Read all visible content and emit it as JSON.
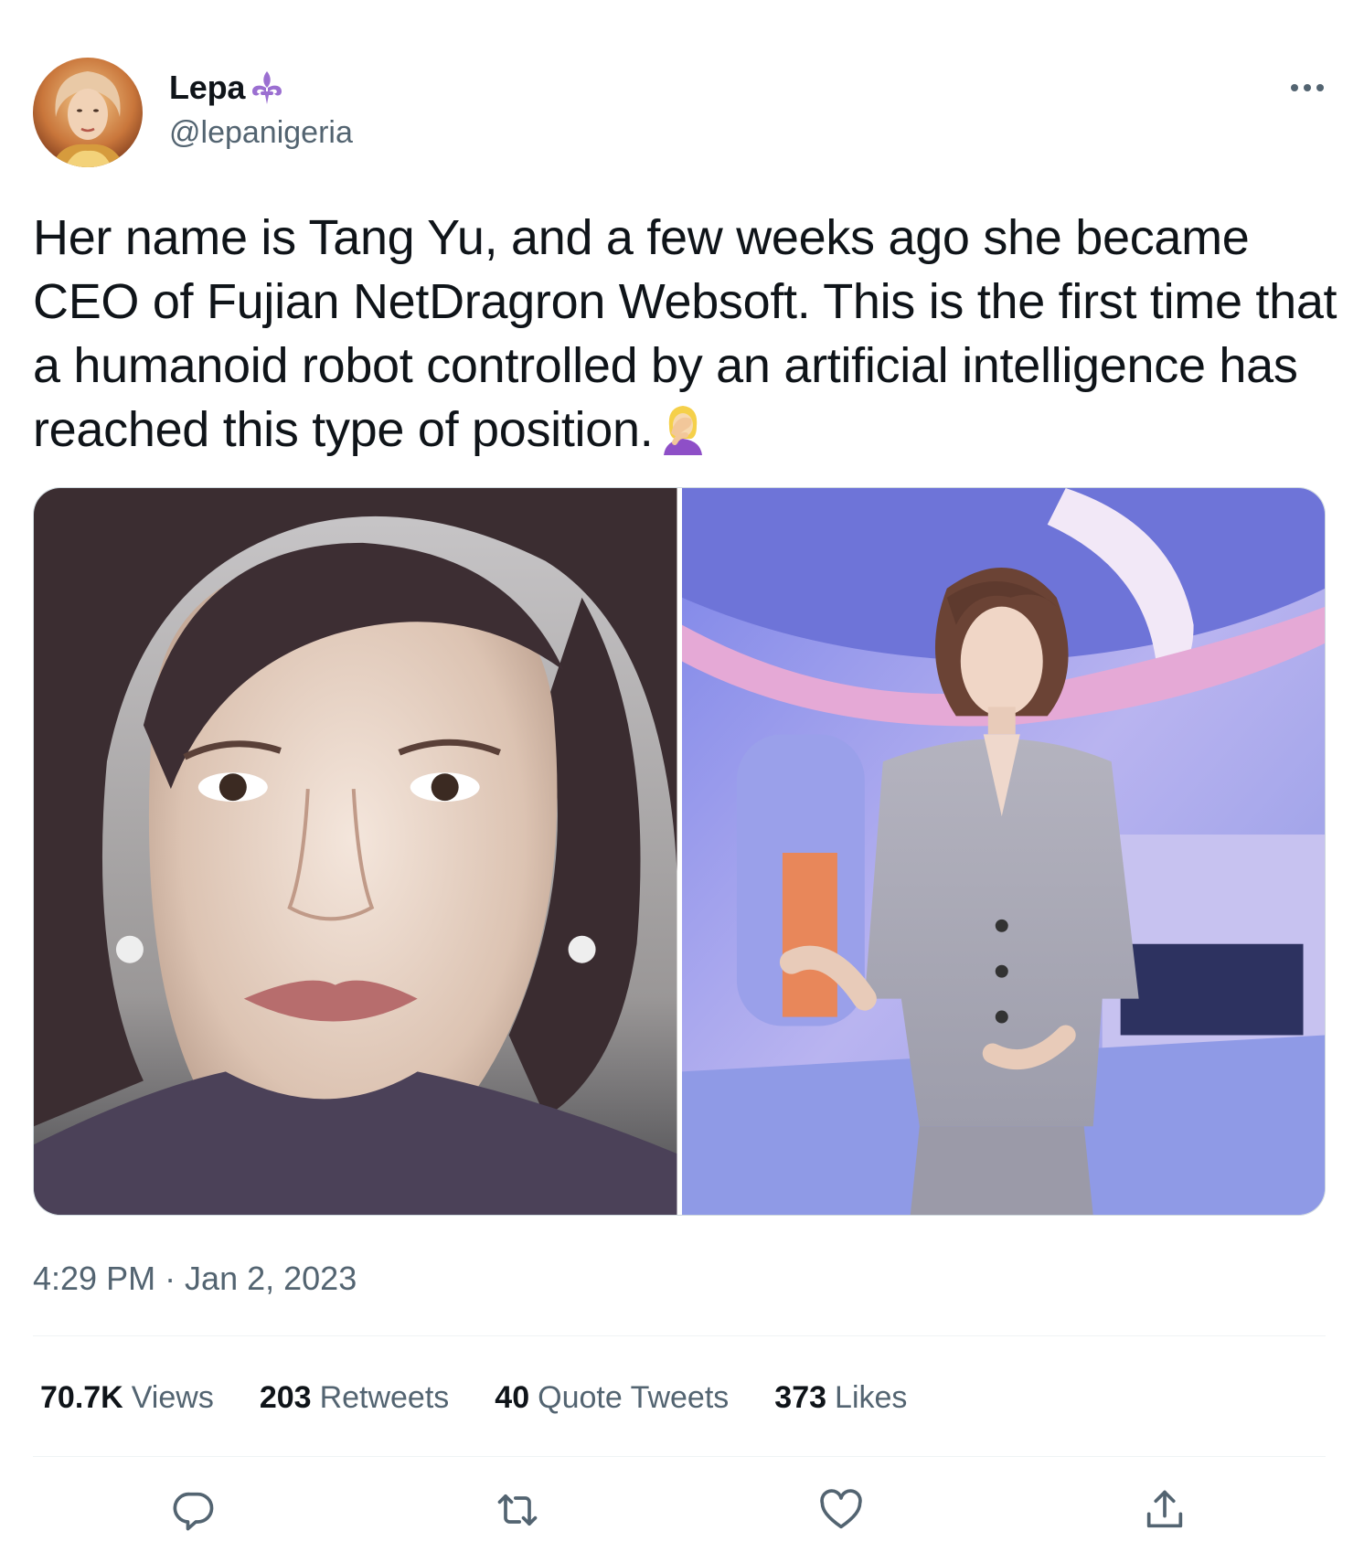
{
  "author": {
    "display_name": "Lepa",
    "handle": "@lepanigeria",
    "name_badge_icon": "fleur-de-lis-icon"
  },
  "tweet": {
    "text": "Her name is Tang Yu, and a few weeks ago she became CEO of Fujian NetDragron Websoft. This is the first time that a humanoid robot controlled by an artificial intelligence has reached this type of position.",
    "emoji": "woman-facepalming-icon",
    "timestamp": "4:29 PM · Jan 2, 2023"
  },
  "media": [
    {
      "icon": "portrait-photo"
    },
    {
      "icon": "full-body-photo"
    }
  ],
  "stats": {
    "views": {
      "count": "70.7K",
      "label": "Views"
    },
    "retweets": {
      "count": "203",
      "label": "Retweets"
    },
    "quote_tweets": {
      "count": "40",
      "label": "Quote Tweets"
    },
    "likes": {
      "count": "373",
      "label": "Likes"
    }
  },
  "actions": [
    "reply-icon",
    "retweet-icon",
    "like-icon",
    "share-icon"
  ],
  "colors": {
    "text_primary": "#0f1419",
    "text_secondary": "#536471",
    "divider": "#eff3f4",
    "badge_purple": "#9b6fd1"
  }
}
